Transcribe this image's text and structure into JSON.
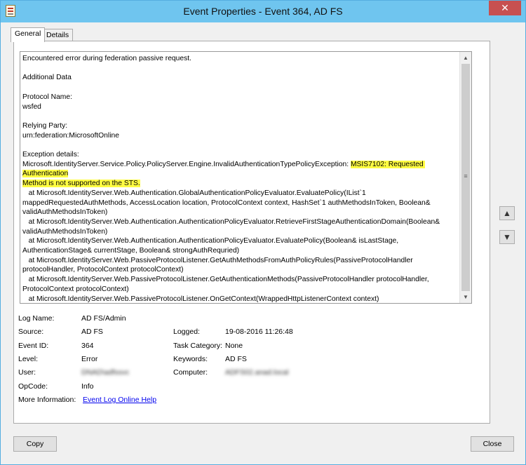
{
  "window": {
    "title": "Event Properties - Event 364, AD FS",
    "close_glyph": "✕"
  },
  "tabs": [
    {
      "label": "General"
    },
    {
      "label": "Details"
    }
  ],
  "message": {
    "line_1": "Encountered error during federation passive request.",
    "line_2": "Additional Data",
    "line_3": "Protocol Name:",
    "line_4": "wsfed",
    "line_5": "Relying Party:",
    "line_6": "urn:federation:MicrosoftOnline",
    "line_7": "Exception details:",
    "exception_prefix": "Microsoft.IdentityServer.Service.Policy.PolicyServer.Engine.InvalidAuthenticationTypePolicyException: ",
    "highlight_1": "MSIS7102: Requested Authentication",
    "highlight_2": "Method is not supported on the STS.",
    "stack": "   at Microsoft.IdentityServer.Web.Authentication.GlobalAuthenticationPolicyEvaluator.EvaluatePolicy(IList`1 mappedRequestedAuthMethods, AccessLocation location, ProtocolContext context, HashSet`1 authMethodsInToken, Boolean& validAuthMethodsInToken)\n   at Microsoft.IdentityServer.Web.Authentication.AuthenticationPolicyEvaluator.RetrieveFirstStageAuthenticationDomain(Boolean& validAuthMethodsInToken)\n   at Microsoft.IdentityServer.Web.Authentication.AuthenticationPolicyEvaluator.EvaluatePolicy(Boolean& isLastStage, AuthenticationStage& currentStage, Boolean& strongAuthRequried)\n   at Microsoft.IdentityServer.Web.PassiveProtocolListener.GetAuthMethodsFromAuthPolicyRules(PassiveProtocolHandler protocolHandler, ProtocolContext protocolContext)\n   at Microsoft.IdentityServer.Web.PassiveProtocolListener.GetAuthenticationMethods(PassiveProtocolHandler protocolHandler, ProtocolContext protocolContext)\n   at Microsoft.IdentityServer.Web.PassiveProtocolListener.OnGetContext(WrappedHttpListenerContext context)"
  },
  "details": {
    "log_name": {
      "label": "Log Name:",
      "value": "AD FS/Admin"
    },
    "source": {
      "label": "Source:",
      "value": "AD FS"
    },
    "logged": {
      "label": "Logged:",
      "value": "19-08-2016 11:26:48"
    },
    "event_id": {
      "label": "Event ID:",
      "value": "364"
    },
    "task_category": {
      "label": "Task Category:",
      "value": "None"
    },
    "level": {
      "label": "Level:",
      "value": "Error"
    },
    "keywords": {
      "label": "Keywords:",
      "value": "AD FS"
    },
    "user": {
      "label": "User:",
      "value": "DNAD\\adfssvc"
    },
    "computer": {
      "label": "Computer:",
      "value": "ADFS02.anad.local"
    },
    "opcode": {
      "label": "OpCode:",
      "value": "Info"
    },
    "more_info": {
      "label": "More Information:",
      "link": "Event Log Online Help"
    }
  },
  "nav": {
    "up_glyph": "▲",
    "down_glyph": "▼"
  },
  "buttons": {
    "copy": "Copy",
    "close": "Close"
  },
  "colors": {
    "title_bar": "#6fc5ef",
    "close_button": "#c75050",
    "highlight": "#fffc42",
    "link": "#0000ee"
  }
}
